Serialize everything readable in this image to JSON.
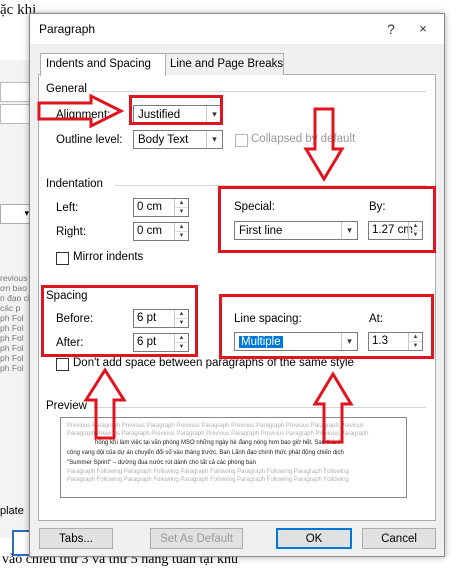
{
  "background": {
    "top_text": "ặc khi",
    "truncated_text": "ì",
    "preview_lines": [
      "revious P",
      "ơn bao",
      "n đạo ch",
      "các p",
      "ph Fol",
      "ph Fol",
      "ph Fol",
      "ph Fol",
      "ph Fol",
      "ph Fol"
    ],
    "bottom_left_text": "plate",
    "bottom_text": "vào chiều thứ 3 và thứ 5 hàng tuần tại khu"
  },
  "dialog": {
    "title": "Paragraph",
    "help_icon": "?",
    "close_icon": "×",
    "tabs": [
      {
        "label": "Indents and Spacing",
        "active": true
      },
      {
        "label": "Line and Page Breaks",
        "active": false
      }
    ],
    "general": {
      "heading": "General",
      "alignment_label": "Alignment:",
      "alignment_value": "Justified",
      "outline_label": "Outline level:",
      "outline_value": "Body Text",
      "collapsed_label": "Collapsed by default"
    },
    "indentation": {
      "heading": "Indentation",
      "left_label": "Left:",
      "left_value": "0 cm",
      "right_label": "Right:",
      "right_value": "0 cm",
      "special_label": "Special:",
      "special_value": "First line",
      "by_label": "By:",
      "by_value": "1.27 cm",
      "mirror_label": "Mirror indents"
    },
    "spacing": {
      "heading": "Spacing",
      "before_label": "Before:",
      "before_value": "6 pt",
      "after_label": "After:",
      "after_value": "6 pt",
      "line_spacing_label": "Line spacing:",
      "line_spacing_value": "Multiple",
      "at_label": "At:",
      "at_value": "1.3",
      "dont_add_label": "Don't add space between paragraphs of the same style"
    },
    "preview": {
      "heading": "Preview",
      "prev_lines": [
        "Previous Paragraph Previous Paragraph Previous Paragraph Previous Paragraph Previous Paragraph Previous",
        "Paragraph Previous Paragraph Previous Paragraph Previous Paragraph Previous Paragraph Previous Paragraph"
      ],
      "body_lines": [
        "hồng khí làm việc tại văn phòng MSO những ngày hè đang nóng hơn bao giờ hết. Sau thành",
        "công vang dội của dự án chuyển đổi số vào tháng trước, Ban Lãnh đạo chính thức phát động chiến dịch",
        "\"Summer Sprint\" – dường đua nước rút dành cho tất cả các phòng ban"
      ],
      "next_lines": [
        "Paragraph Following Paragraph Following Paragraph Following Paragraph Following Paragraph Following",
        "Paragraph Following Paragraph Following Paragraph Following Paragraph Following Paragraph Following"
      ]
    },
    "buttons": {
      "tabs": "Tabs...",
      "set_default": "Set As Default",
      "ok": "OK",
      "cancel": "Cancel"
    }
  },
  "annotation_color": "#e0141e"
}
